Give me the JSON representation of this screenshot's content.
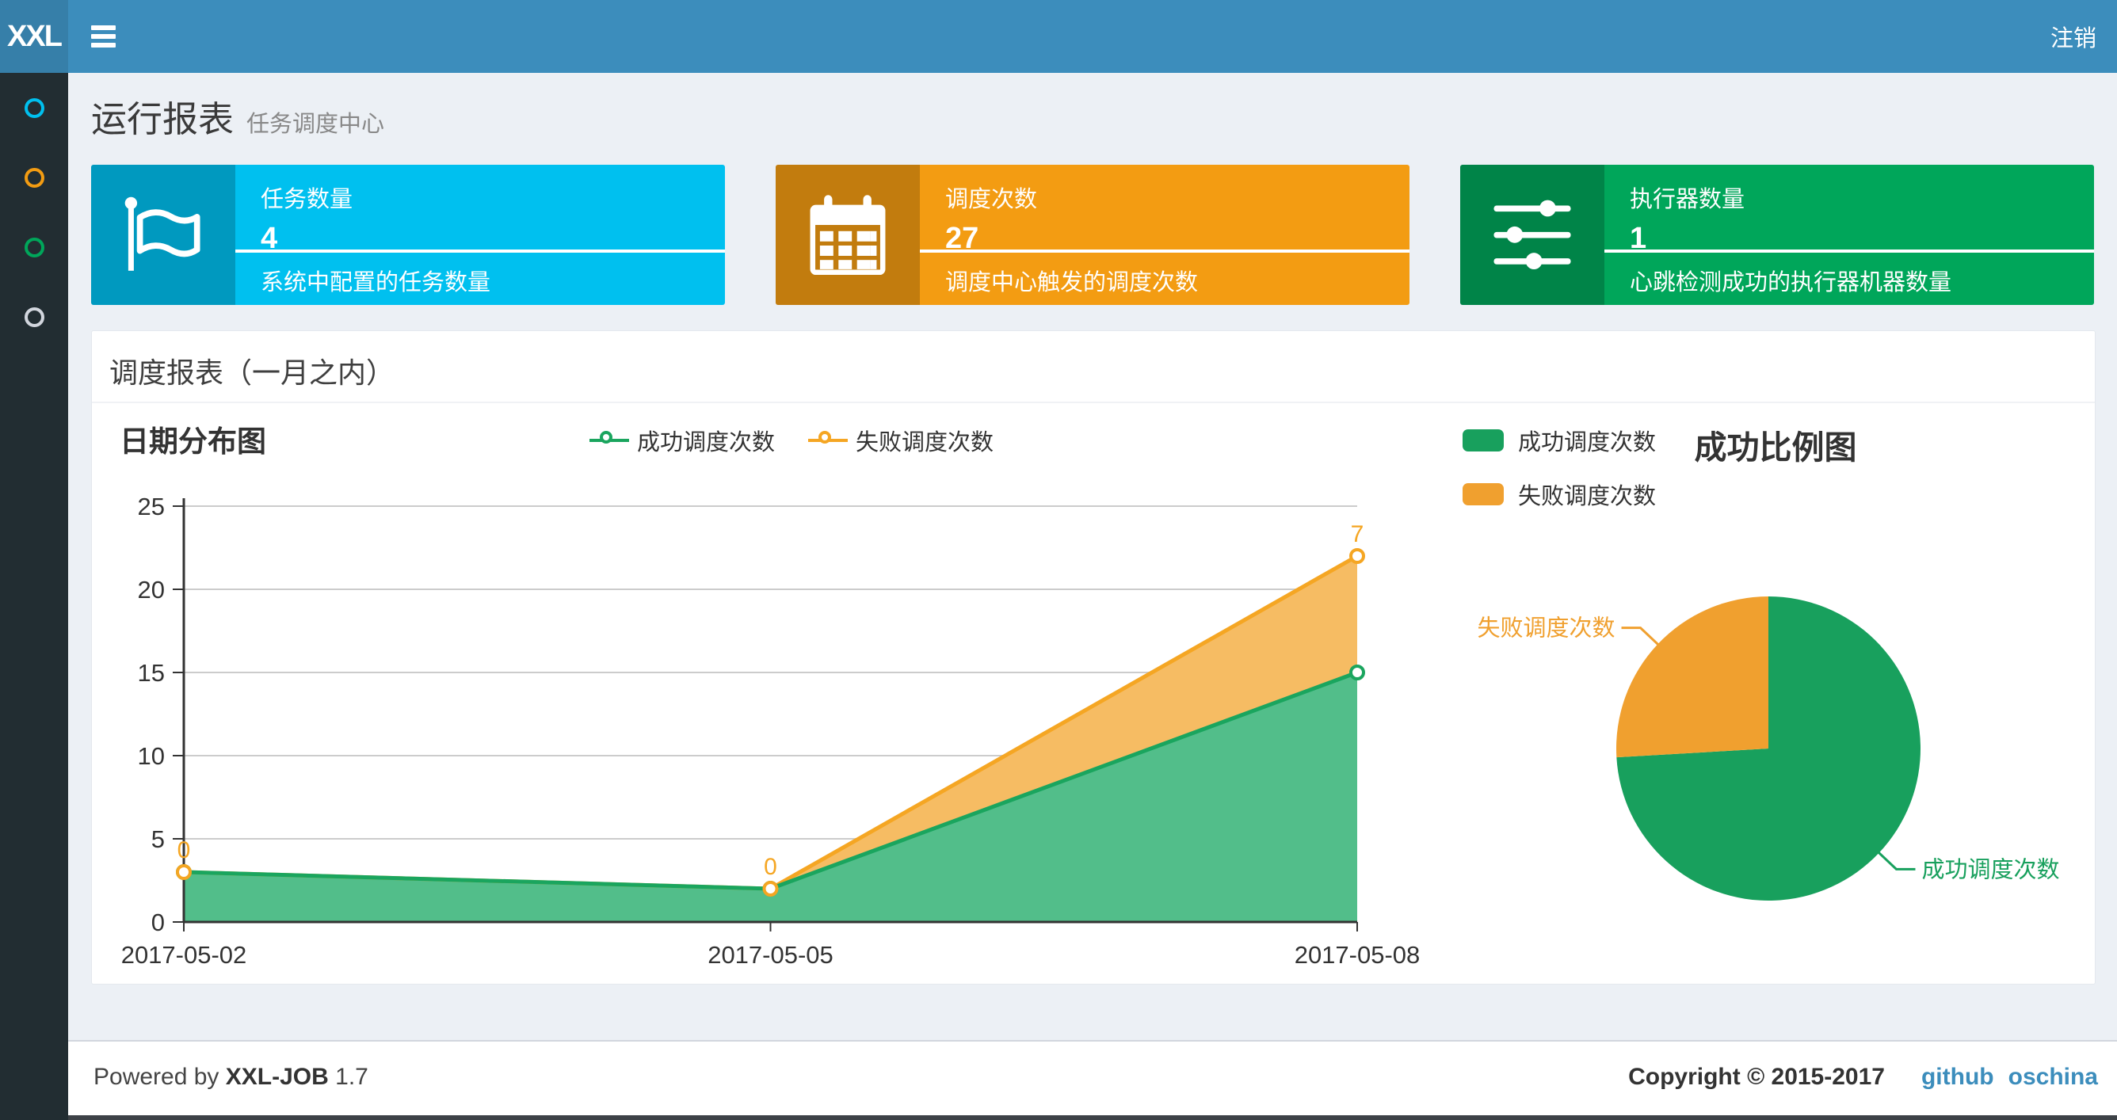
{
  "header": {
    "logo_text": "XXL",
    "logout_label": "注销"
  },
  "sidebar": {
    "items": [
      {
        "name": "menu-report",
        "icon": "circle-icon",
        "color": "#00c0ef"
      },
      {
        "name": "menu-jobs",
        "icon": "circle-icon",
        "color": "#f39c12"
      },
      {
        "name": "menu-joblog",
        "icon": "circle-icon",
        "color": "#00a65a"
      },
      {
        "name": "menu-executor",
        "icon": "circle-icon",
        "color": "#d2d6de"
      }
    ]
  },
  "page": {
    "title": "运行报表",
    "subtitle": "任务调度中心"
  },
  "stat_cards": [
    {
      "label": "任务数量",
      "value": "4",
      "desc": "系统中配置的任务数量",
      "color": "#00c0ef",
      "icon": "flag-icon"
    },
    {
      "label": "调度次数",
      "value": "27",
      "desc": "调度中心触发的调度次数",
      "color": "#f39c12",
      "icon": "calendar-icon"
    },
    {
      "label": "执行器数量",
      "value": "1",
      "desc": "心跳检测成功的执行器机器数量",
      "color": "#00a65a",
      "icon": "sliders-icon"
    }
  ],
  "panel": {
    "title": "调度报表（一月之内）"
  },
  "chart_data": [
    {
      "type": "area",
      "title": "日期分布图",
      "stacked": true,
      "x": [
        "2017-05-02",
        "2017-05-05",
        "2017-05-08"
      ],
      "series": [
        {
          "name": "成功调度次数",
          "values": [
            3,
            2,
            15
          ],
          "line_color": "#1AA55E",
          "fill_color": "#52BE8A"
        },
        {
          "name": "失败调度次数",
          "values": [
            0,
            0,
            7
          ],
          "line_color": "#F5A623",
          "fill_color": "#F6BC63",
          "data_labels": [
            "0",
            "0",
            "7"
          ]
        }
      ],
      "ylim": [
        0,
        25
      ],
      "yticks": [
        0,
        5,
        10,
        15,
        20,
        25
      ],
      "grid": true,
      "legend_position": "top"
    },
    {
      "type": "pie",
      "title": "成功比例图",
      "slices": [
        {
          "label": "成功调度次数",
          "value": 20,
          "color": "#18A05D"
        },
        {
          "label": "失败调度次数",
          "value": 7,
          "color": "#F0A02F"
        }
      ],
      "legend_position": "top-left",
      "start_angle": "top",
      "direction": "clockwise"
    }
  ],
  "footer": {
    "powered_prefix": "Powered by",
    "product": "XXL-JOB",
    "version": "1.7",
    "copyright": "Copyright © 2015-2017",
    "links": [
      {
        "label": "github"
      },
      {
        "label": "oschina"
      }
    ],
    "link_color": "#3c8dbc"
  }
}
